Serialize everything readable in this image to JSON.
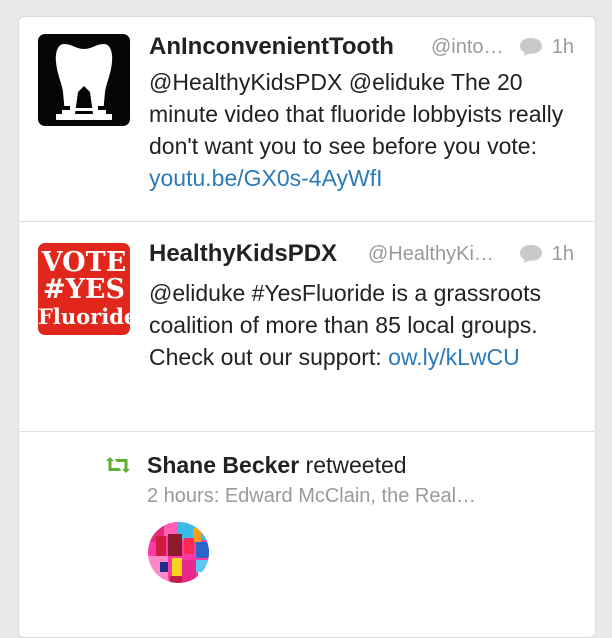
{
  "tweets": [
    {
      "name": "AnInconvenientTooth",
      "handle": "@into…",
      "time": "1h",
      "text": "@HealthyKidsPDX @eliduke The 20 minute video that fluoride lobbyists really don't want you to see before you vote: ",
      "link": "youtu.be/GX0s-4AyWfI",
      "avatar_icon": "tooth-icon"
    },
    {
      "name": "HealthyKidsPDX",
      "handle": "@HealthyKi…",
      "time": "1h",
      "text": "@eliduke #YesFluoride is a grassroots coalition of more than 85 local groups. Check out our support: ",
      "link": "ow.ly/kLwCU",
      "avatar_text": [
        "VOTE",
        "#YES",
        "Fluoride"
      ]
    }
  ],
  "retweet": {
    "name": "Shane Becker",
    "action": "retweeted",
    "preview": "2 hours: Edward McClain, the Real…",
    "icon": "retweet-icon"
  },
  "colors": {
    "link": "#2b7bb9",
    "retweet_green": "#5eb033",
    "vote_red": "#e1261c"
  }
}
